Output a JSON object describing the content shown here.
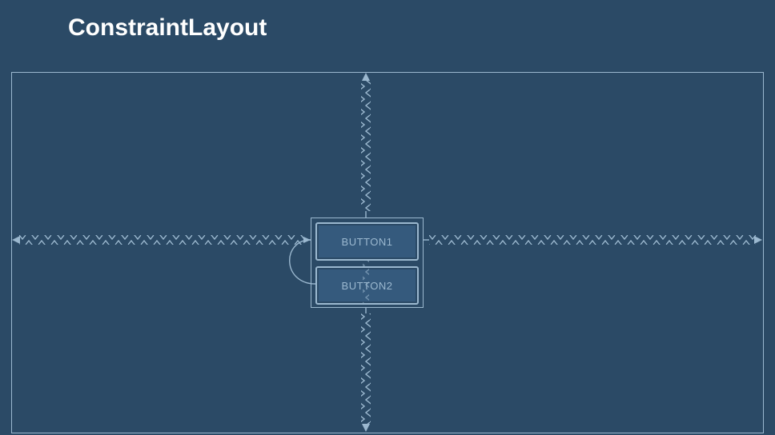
{
  "title": "ConstraintLayout",
  "buttons": {
    "b1": "BUTTON1",
    "b2": "BUTTON2"
  },
  "colors": {
    "bg": "#2b4a66",
    "line": "#9bb8cf",
    "buttonFill": "#355a7d"
  }
}
